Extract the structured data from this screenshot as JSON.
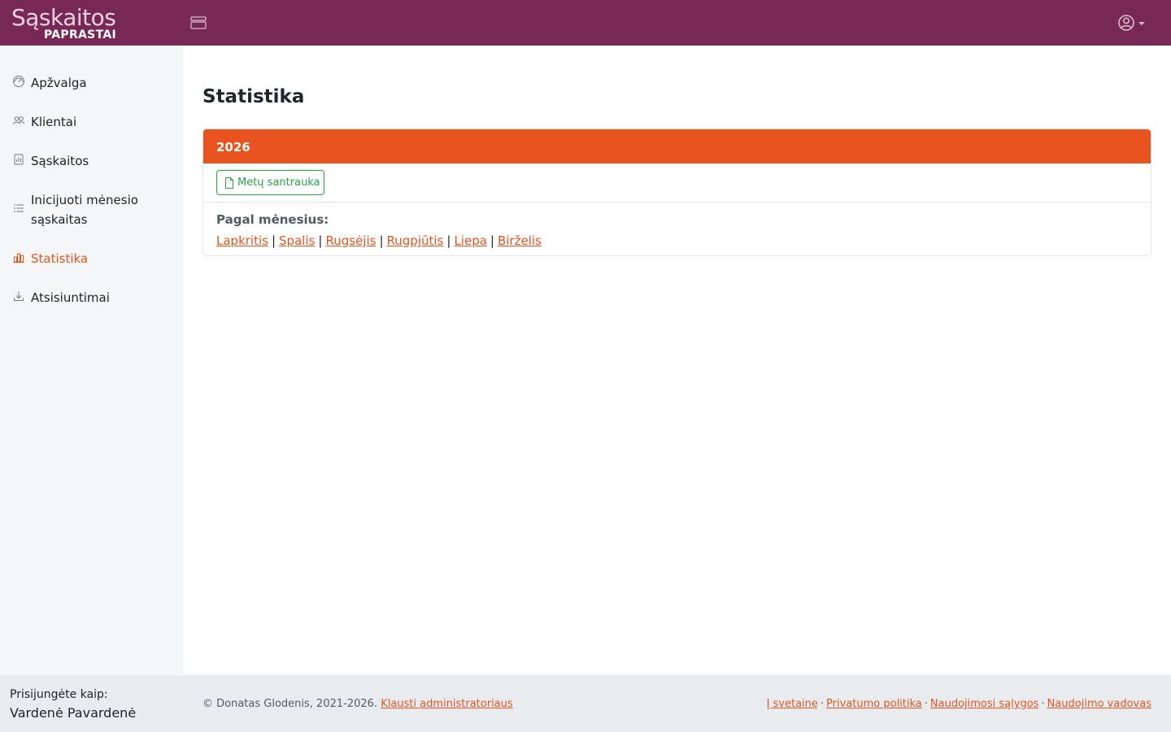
{
  "header": {
    "brand_top": "Sąskaitos",
    "brand_bottom": "PAPRASTAI",
    "bg_color": "#782854"
  },
  "sidebar": {
    "items": [
      {
        "label": "Apžvalga",
        "icon": "dashboard-icon",
        "active": false
      },
      {
        "label": "Klientai",
        "icon": "users-icon",
        "active": false
      },
      {
        "label": "Sąskaitos",
        "icon": "invoice-icon",
        "active": false
      },
      {
        "label": "Inicijuoti mėnesio sąskaitas",
        "icon": "list-icon",
        "active": false
      },
      {
        "label": "Statistika",
        "icon": "statistics-icon",
        "active": true
      },
      {
        "label": "Atsisiuntimai",
        "icon": "download-icon",
        "active": false
      }
    ]
  },
  "main": {
    "title": "Statistika",
    "card": {
      "year": "2026",
      "summary_button": "Metų santrauka",
      "by_month_label": "Pagal mėnesius:",
      "months": [
        "Lapkritis",
        "Spalis",
        "Rugsėjis",
        "Rugpjūtis",
        "Liepa",
        "Birželis"
      ],
      "separator": "|"
    }
  },
  "footer": {
    "logged_label": "Prisijungėte kaip:",
    "logged_name": "Vardenė Pavardenė",
    "copyright": "© Donatas Glodenis, 2021-2026.",
    "contact_link": "Klausti administratoriaus",
    "links": [
      "Į svetainę",
      "Privatumo politika",
      "Naudojimosi sąlygos",
      "Naudojimo vadovas"
    ],
    "link_separator": "·"
  },
  "colors": {
    "accent": "#e8531f",
    "success": "#28a745",
    "sidebar_bg": "#f5f6f8",
    "footer_bg": "#e9ecef"
  }
}
